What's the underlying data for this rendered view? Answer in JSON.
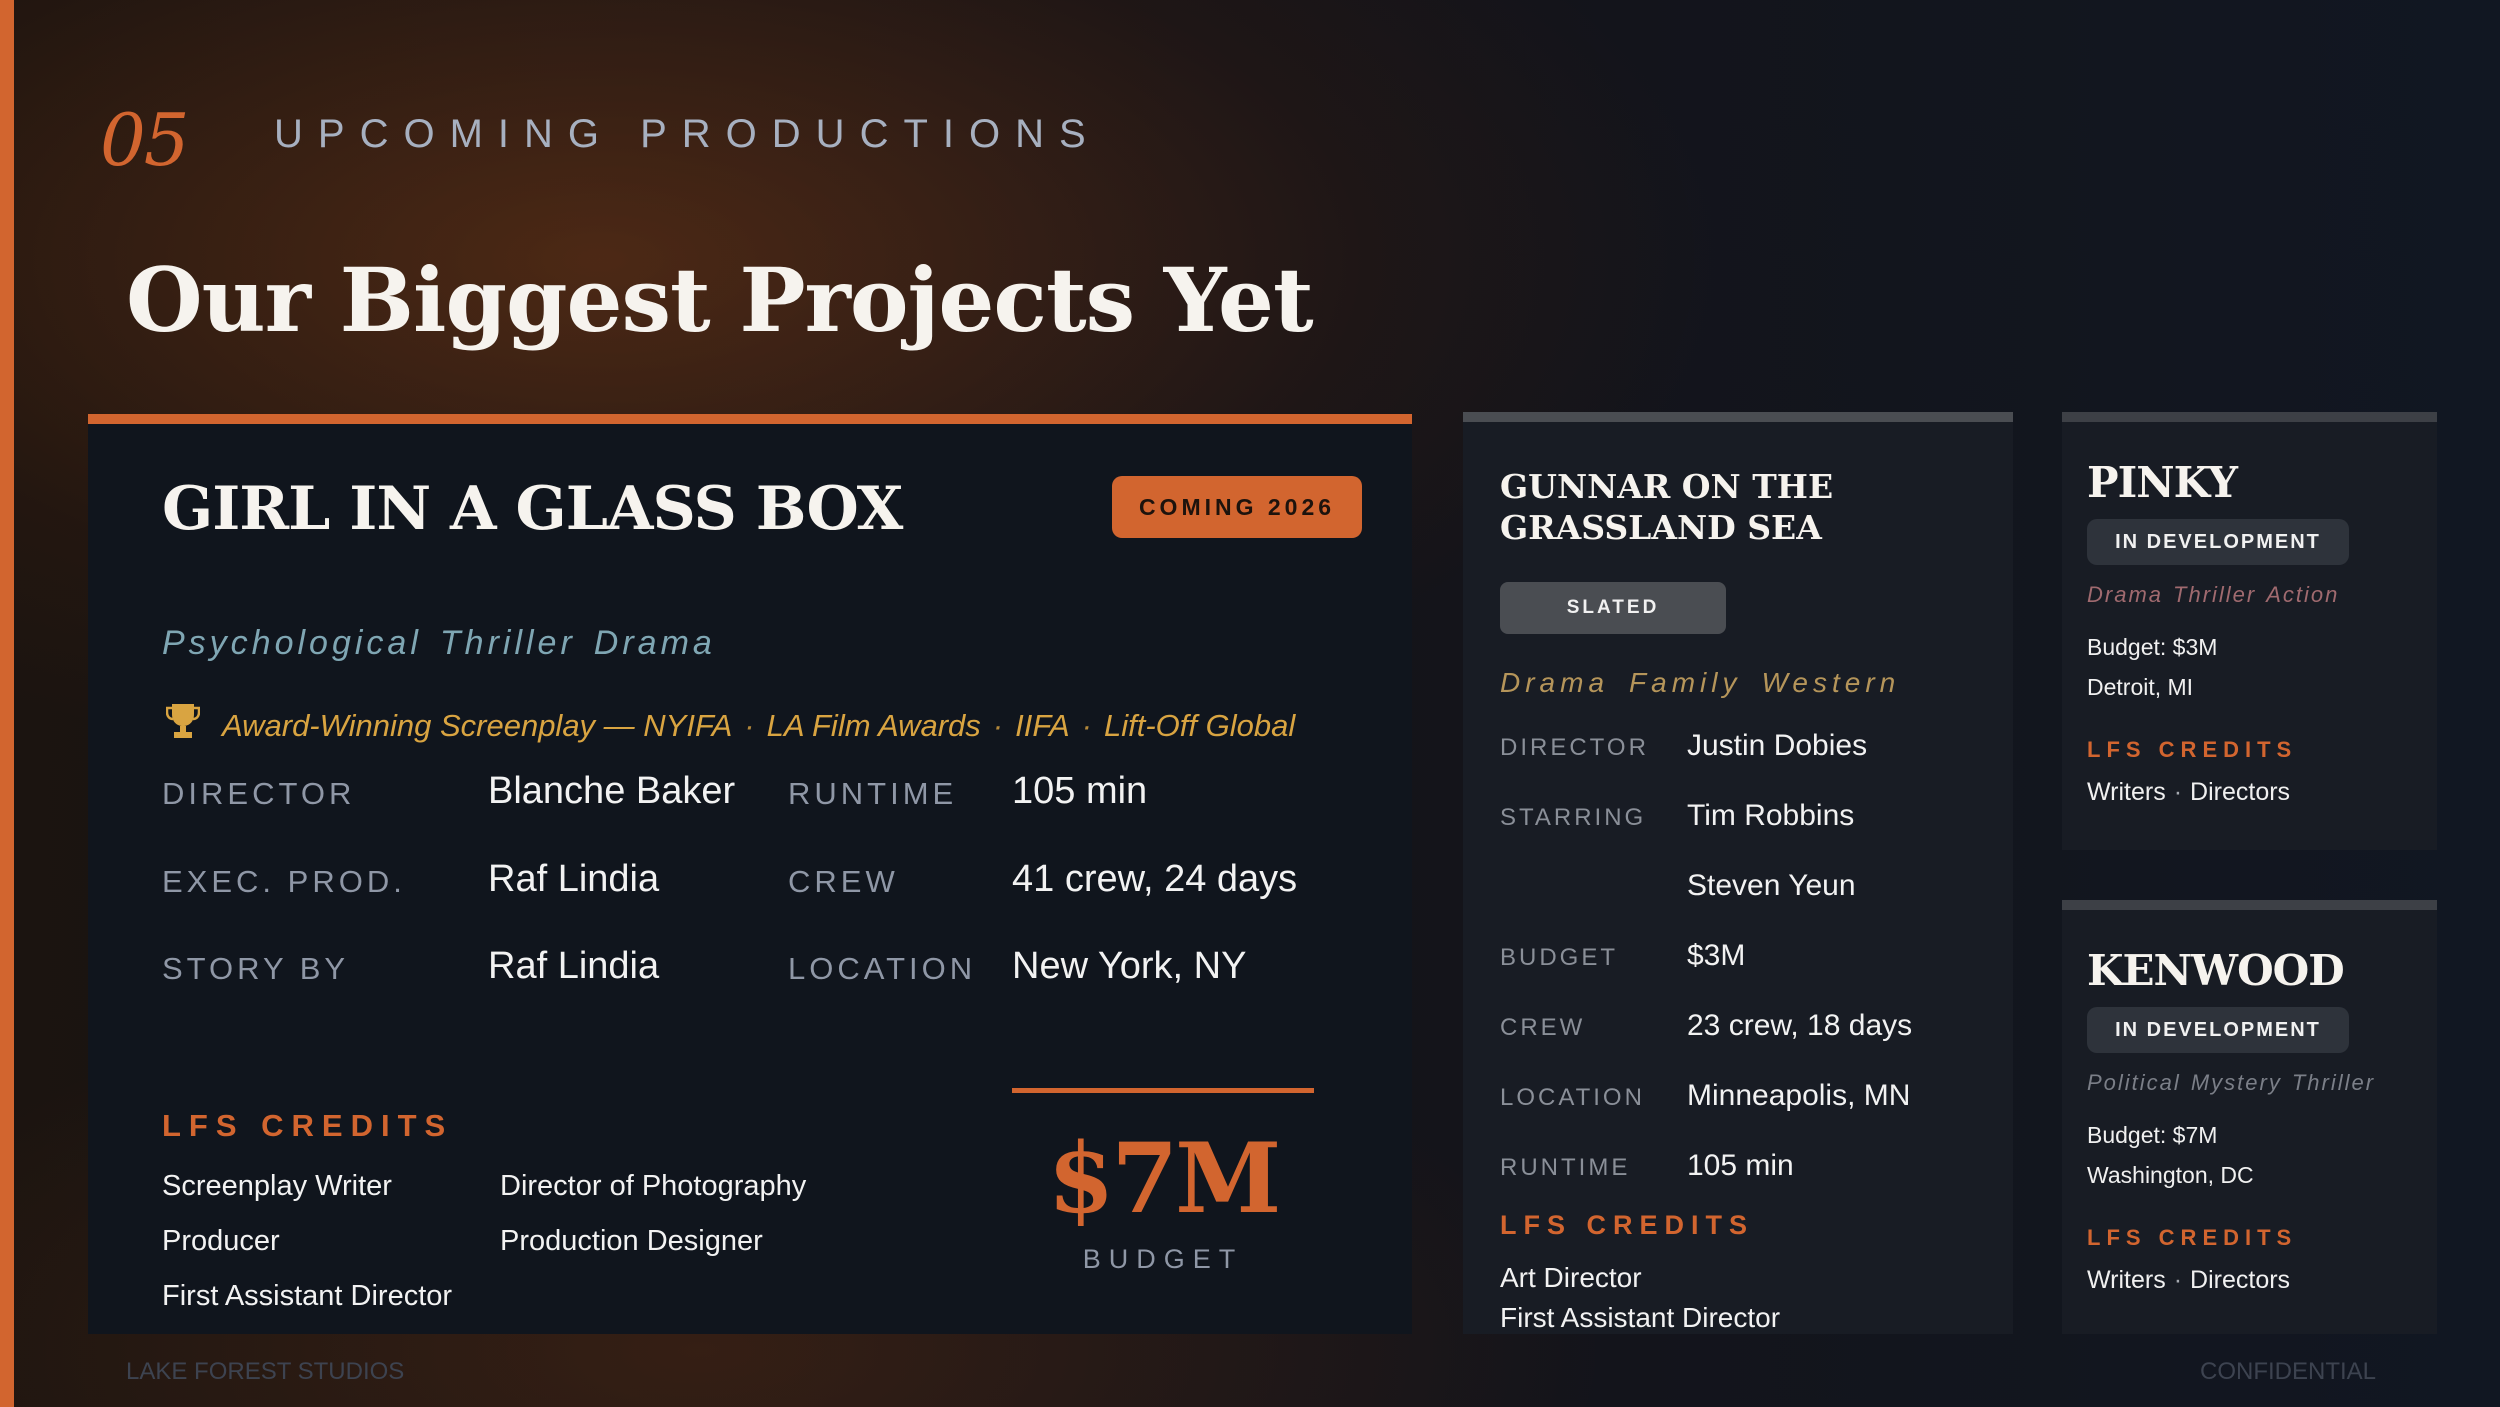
{
  "section": {
    "number": "05",
    "title": "UPCOMING PRODUCTIONS"
  },
  "headline": "Our Biggest Projects Yet",
  "colors": {
    "accent": "#d2652f",
    "gold": "#d9a441",
    "teal": "#7fa6b3",
    "bg": "#10151d"
  },
  "main_project": {
    "title": "GIRL IN A GLASS BOX",
    "badge": "COMING 2026",
    "genres": [
      "Psychological",
      "Thriller",
      "Drama"
    ],
    "award_icon": "trophy-icon",
    "award_lead": "Award-Winning Screenplay — NYIFA",
    "awards_rest": [
      "LA Film Awards",
      "IIFA",
      "Lift-Off Global"
    ],
    "award_separator": "·",
    "details_left": [
      {
        "label": "DIRECTOR",
        "value": "Blanche Baker"
      },
      {
        "label": "EXEC. PROD.",
        "value": "Raf Lindia"
      },
      {
        "label": "STORY BY",
        "value": "Raf Lindia"
      }
    ],
    "details_right": [
      {
        "label": "RUNTIME",
        "value": "105 min"
      },
      {
        "label": "CREW",
        "value": "41 crew, 24 days"
      },
      {
        "label": "LOCATION",
        "value": "New York, NY"
      }
    ],
    "credits_heading": "LFS CREDITS",
    "credits_col1": [
      "Screenplay Writer",
      "Producer",
      "First Assistant Director"
    ],
    "credits_col2": [
      "Director of Photography",
      "Production Designer"
    ],
    "budget_value": "$7M",
    "budget_label": "BUDGET"
  },
  "gunnar": {
    "title": "GUNNAR ON THE GRASSLAND SEA",
    "badge": "SLATED",
    "genres": [
      "Drama",
      "Family",
      "Western"
    ],
    "details": [
      {
        "label": "DIRECTOR",
        "value": "Justin Dobies"
      },
      {
        "label": "STARRING",
        "value": "Tim Robbins"
      },
      {
        "label": "",
        "value": "Steven Yeun"
      },
      {
        "label": "BUDGET",
        "value": "$3M"
      },
      {
        "label": "CREW",
        "value": "23 crew, 18 days"
      },
      {
        "label": "LOCATION",
        "value": "Minneapolis, MN"
      },
      {
        "label": "RUNTIME",
        "value": "105 min"
      }
    ],
    "credits_heading": "LFS CREDITS",
    "credits": [
      "Art Director",
      "First Assistant Director"
    ]
  },
  "pinky": {
    "title": "PINKY",
    "badge": "IN DEVELOPMENT",
    "genres": [
      "Drama",
      "Thriller",
      "Action"
    ],
    "budget": "Budget: $3M",
    "location": "Detroit, MI",
    "credits_heading": "LFS CREDITS",
    "credits": [
      "Writers",
      "Directors"
    ],
    "credit_separator": "·"
  },
  "kenwood": {
    "title": "KENWOOD",
    "badge": "IN DEVELOPMENT",
    "genres": [
      "Political",
      "Mystery",
      "Thriller"
    ],
    "budget": "Budget: $7M",
    "location": "Washington, DC",
    "credits_heading": "LFS CREDITS",
    "credits": [
      "Writers",
      "Directors"
    ],
    "credit_separator": "·"
  },
  "footer": {
    "left": "LAKE FOREST STUDIOS",
    "right": "CONFIDENTIAL"
  }
}
